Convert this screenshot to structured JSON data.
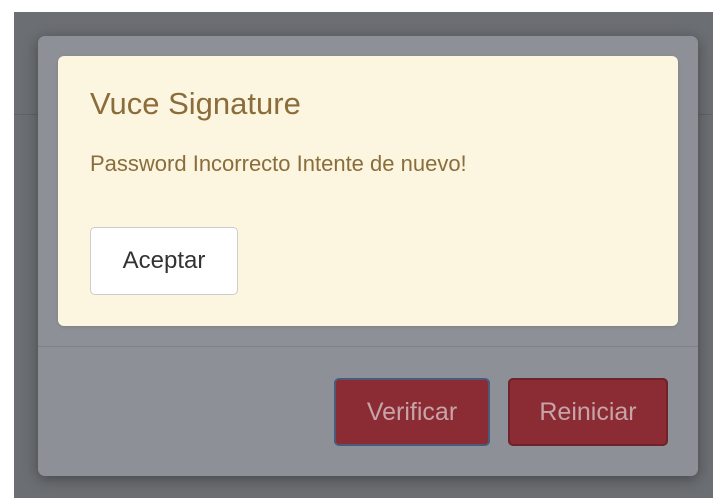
{
  "alert": {
    "title": "Vuce Signature",
    "message": "Password Incorrecto Intente de nuevo!",
    "accept_label": "Aceptar"
  },
  "modal": {
    "verify_label": "Verificar",
    "reset_label": "Reiniciar"
  },
  "colors": {
    "alert_background": "#fcf5e0",
    "alert_text": "#8a6d3b",
    "danger_button": "#8b2c34",
    "overlay": "#6b6e72",
    "modal_background": "#8d9096"
  }
}
